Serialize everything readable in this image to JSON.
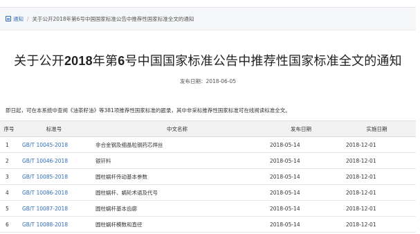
{
  "breadcrumb": {
    "home": "通知",
    "separator": "/",
    "current": "关于公开2018年第6号中国国家标准公告中推荐性国家标准全文的通知"
  },
  "title": {
    "part1": "关于公开",
    "year": "2018",
    "part2": "年第",
    "num": "6",
    "part3": "号中国国家标准公告中推荐性国家标准全文的通知"
  },
  "publish_date": "发布日期：2018-06-05",
  "intro": "即日起，可在本系统中查阅《油茶籽油》等381项推荐性国家标准的题录，其中非采标推荐性国家标准可在线阅读标准全文。",
  "table": {
    "headers": [
      "序号",
      "标准号",
      "中文名称",
      "发布日期",
      "实施日期"
    ],
    "rows": [
      {
        "idx": "1",
        "code": "GB/T 10045-2018",
        "name": "非合金钢及细晶粒钢药芯焊丝",
        "pub": "2018-05-14",
        "impl": "2018-12-01"
      },
      {
        "idx": "2",
        "code": "GB/T 10046-2018",
        "name": "银钎料",
        "pub": "2018-05-14",
        "impl": "2018-12-01"
      },
      {
        "idx": "3",
        "code": "GB/T 10085-2018",
        "name": "圆柱蜗杆传动基本参数",
        "pub": "2018-05-14",
        "impl": "2018-12-01"
      },
      {
        "idx": "4",
        "code": "GB/T 10086-2018",
        "name": "圆柱蜗杆、蜗轮术语及代号",
        "pub": "2018-05-14",
        "impl": "2018-12-01"
      },
      {
        "idx": "5",
        "code": "GB/T 10087-2018",
        "name": "圆柱蜗杆基本齿廓",
        "pub": "2018-05-14",
        "impl": "2018-12-01"
      },
      {
        "idx": "6",
        "code": "GB/T 10088-2018",
        "name": "圆柱蜗杆模数和直径",
        "pub": "2018-05-14",
        "impl": "2018-12-01"
      }
    ]
  },
  "colors": {
    "link": "#2f6db5",
    "header_bg": "#f2f2f2"
  }
}
